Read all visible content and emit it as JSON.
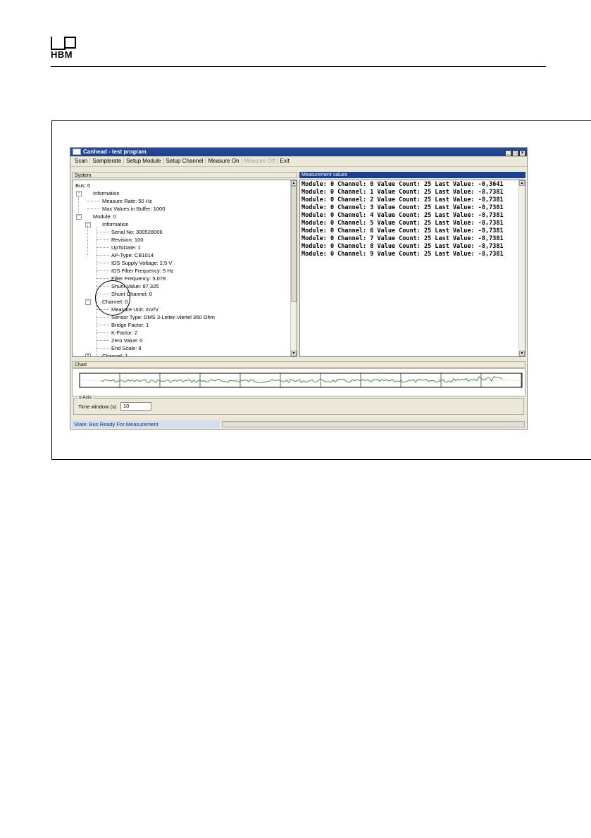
{
  "header": {
    "logo_text": "HBM"
  },
  "window": {
    "title": "Canhead - test program",
    "buttons": [
      "_",
      "□",
      "×"
    ],
    "menu": [
      "Scan",
      "Samplerate",
      "Setup Module",
      "Setup Channel",
      "Measure On",
      "Measure Off",
      "Exit"
    ],
    "system_header": "System",
    "measurement_header": "Measurement values",
    "tree": [
      "Bus: 0",
      "Information",
      "Measure Rate: 50 Hz",
      "Max Values in Buffer: 1000",
      "Module: 0",
      "Information",
      "Serial No: 300528006",
      "Revision: 100",
      "UpToDate: 1",
      "AP-Type: CB1014",
      "IDS Supply Voltage: 2,5 V",
      "IDS Filter Frequency: 5 Hz",
      "Filter Frequency: 5,078",
      "Shunt Value: 87,325",
      "Shunt Channel: 0",
      "Channel: 0",
      "Measure Unit: mV/V",
      "Sensor Type: DMS 3-Leiter-Viertel 350 Ohm",
      "Bridge Factor: 1",
      "K-Factor: 2",
      "Zero Value: 0",
      "End Scale: 8",
      "Channel: 1"
    ],
    "measurements": [
      "Module: 0 Channel: 0 Value Count: 25 Last Value: -0,3641",
      "Module: 0 Channel: 1 Value Count: 25 Last Value: -8,7381",
      "Module: 0 Channel: 2 Value Count: 25 Last Value: -8,7381",
      "Module: 0 Channel: 3 Value Count: 25 Last Value: -8,7381",
      "Module: 0 Channel: 4 Value Count: 25 Last Value: -8,7381",
      "Module: 0 Channel: 5 Value Count: 25 Last Value: -8,7381",
      "Module: 0 Channel: 6 Value Count: 25 Last Value: -8,7381",
      "Module: 0 Channel: 7 Value Count: 25 Last Value: -8,7381",
      "Module: 0 Channel: 8 Value Count: 25 Last Value: -8,7381",
      "Module: 0 Channel: 9 Value Count: 25 Last Value: -8,7381"
    ],
    "chart_header": "Chart",
    "xaxis_legend": "x-Axis",
    "time_window_label": "Time window (s)",
    "time_window_value": "10",
    "status": "State: Bus Ready For Measurement"
  }
}
